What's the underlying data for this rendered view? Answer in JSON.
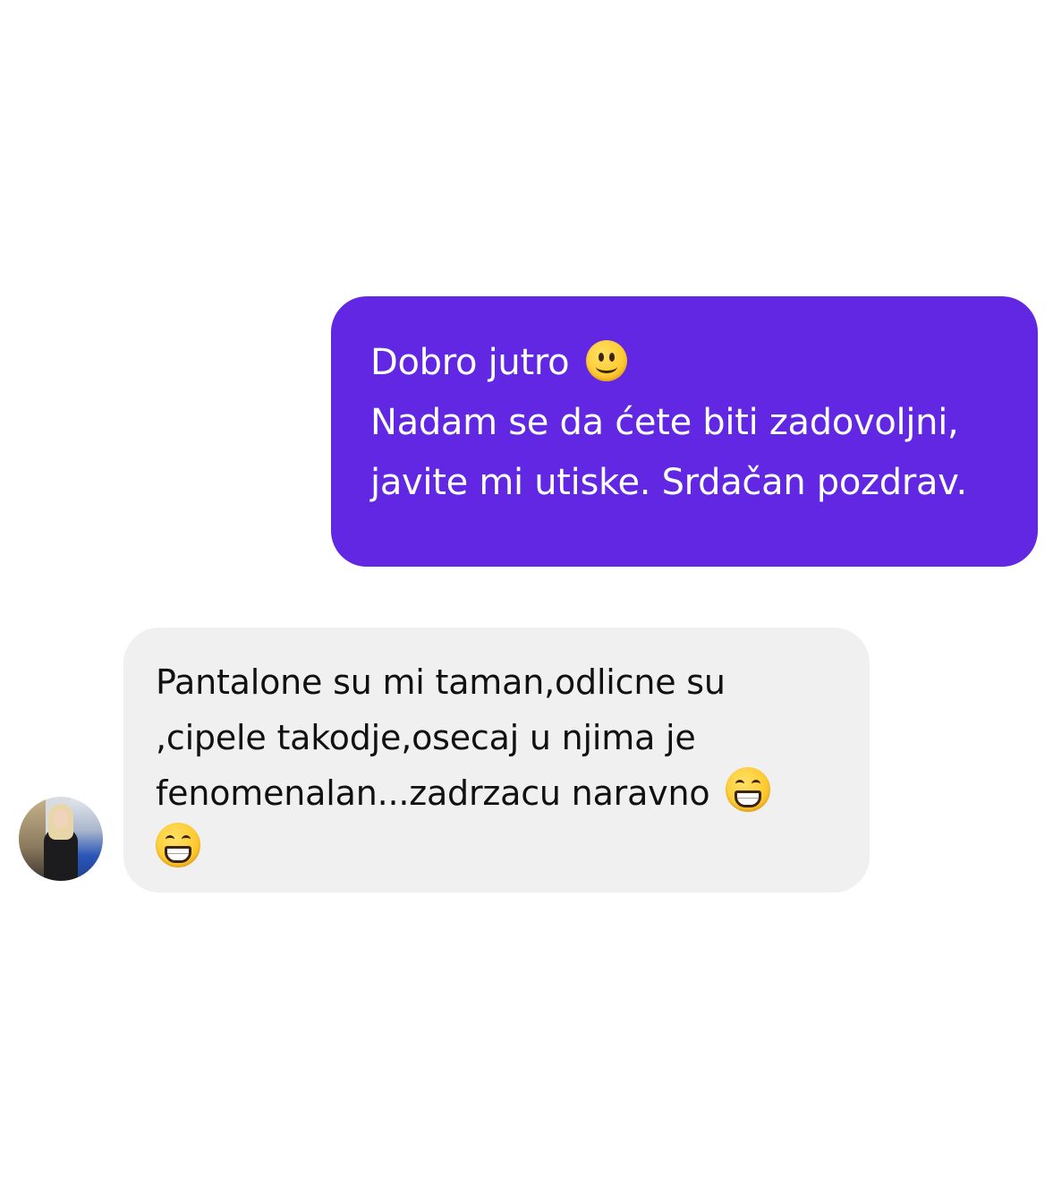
{
  "conversation": {
    "outgoing": {
      "lines": [
        "Dobro jutro",
        "Nadam se da ćete biti zadovoljni,",
        "javite mi utiske. Srdačan pozdrav."
      ],
      "emoji": "smiling-face-icon",
      "color": "#6127e3"
    },
    "incoming": {
      "lines": [
        "Pantalone su mi taman,odlicne su",
        ",cipele takodje,osecaj u njima je",
        "fenomenalan...zadrzacu naravno"
      ],
      "emoji": "grinning-face-icon",
      "color": "#f0f0f0"
    }
  }
}
